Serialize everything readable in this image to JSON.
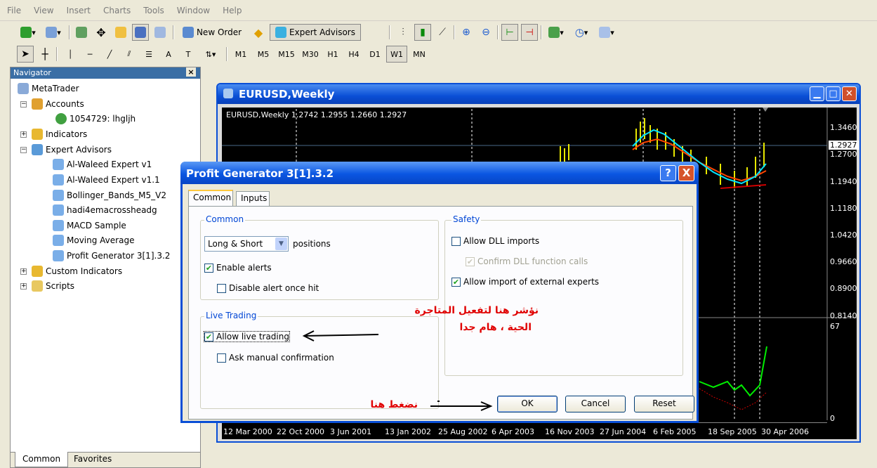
{
  "menu": [
    "File",
    "View",
    "Insert",
    "Charts",
    "Tools",
    "Window",
    "Help"
  ],
  "toolbar1": {
    "new_order": "New Order",
    "expert_advisors": "Expert Advisors"
  },
  "toolbar2": {
    "text_tool": "A",
    "timeframes": [
      "M1",
      "M5",
      "M15",
      "M30",
      "H1",
      "H4",
      "D1",
      "W1",
      "MN"
    ],
    "selected_timeframe": "W1"
  },
  "navigator": {
    "title": "Navigator",
    "close": "×",
    "root": "MetaTrader",
    "accounts": "Accounts",
    "account": "1054729: lhgljh",
    "indicators": "Indicators",
    "expert_advisors": "Expert Advisors",
    "experts": [
      "Al-Waleed Expert v1",
      "Al-Waleed Expert v1.1",
      "Bollinger_Bands_M5_V2",
      "hadi4emacrossheadg",
      "MACD Sample",
      "Moving Average",
      "Profit Generator 3[1].3.2"
    ],
    "custom_indicators": "Custom Indicators",
    "scripts": "Scripts",
    "tabs": [
      "Common",
      "Favorites"
    ]
  },
  "chart_window": {
    "title": "EURUSD,Weekly",
    "header": "EURUSD,Weekly  1.2742 1.2955 1.2660 1.2927",
    "price_labels": [
      "1.3460",
      "1.2927",
      "1.2700",
      "1.1940",
      "1.1180",
      "1.0420",
      "0.9660",
      "0.8900",
      "0.8140"
    ],
    "current_price": "1.2927",
    "subwindow_top": "67",
    "subwindow_bottom": "0",
    "dates": [
      "12 Mar 2000",
      "22 Oct 2000",
      "3 Jun 2001",
      "13 Jan 2002",
      "25 Aug 2002",
      "6 Apr 2003",
      "16 Nov 2003",
      "27 Jun 2004",
      "6 Feb 2005",
      "18 Sep 2005",
      "30 Apr 2006"
    ]
  },
  "dialog": {
    "title": "Profit Generator 3[1].3.2",
    "help": "?",
    "close": "X",
    "tabs": [
      "Common",
      "Inputs"
    ],
    "common_group": "Common",
    "positions_value": "Long & Short",
    "positions_label": "positions",
    "enable_alerts": "Enable alerts",
    "disable_alert": "Disable alert once hit",
    "live_group": "Live Trading",
    "allow_live": "Allow live trading",
    "ask_manual": "Ask manual confirmation",
    "safety_group": "Safety",
    "allow_dll": "Allow DLL imports",
    "confirm_dll": "Confirm DLL function calls",
    "allow_import": "Allow import of external experts",
    "ok": "OK",
    "cancel": "Cancel",
    "reset": "Reset",
    "checks": {
      "enable_alerts": true,
      "disable_alert": false,
      "allow_live": true,
      "ask_manual": false,
      "allow_dll": false,
      "confirm_dll": true,
      "allow_import": true
    }
  },
  "annotations": {
    "note_line1": "نؤشر هنا لتفعيل المتاجرة",
    "note_line2": "الحية ، هام جدا",
    "click_here": "نضغط هنا"
  },
  "colors": {
    "title_blue": "#0a4fd6",
    "annotation_red": "#e00000",
    "group_blue": "#0046d5"
  }
}
